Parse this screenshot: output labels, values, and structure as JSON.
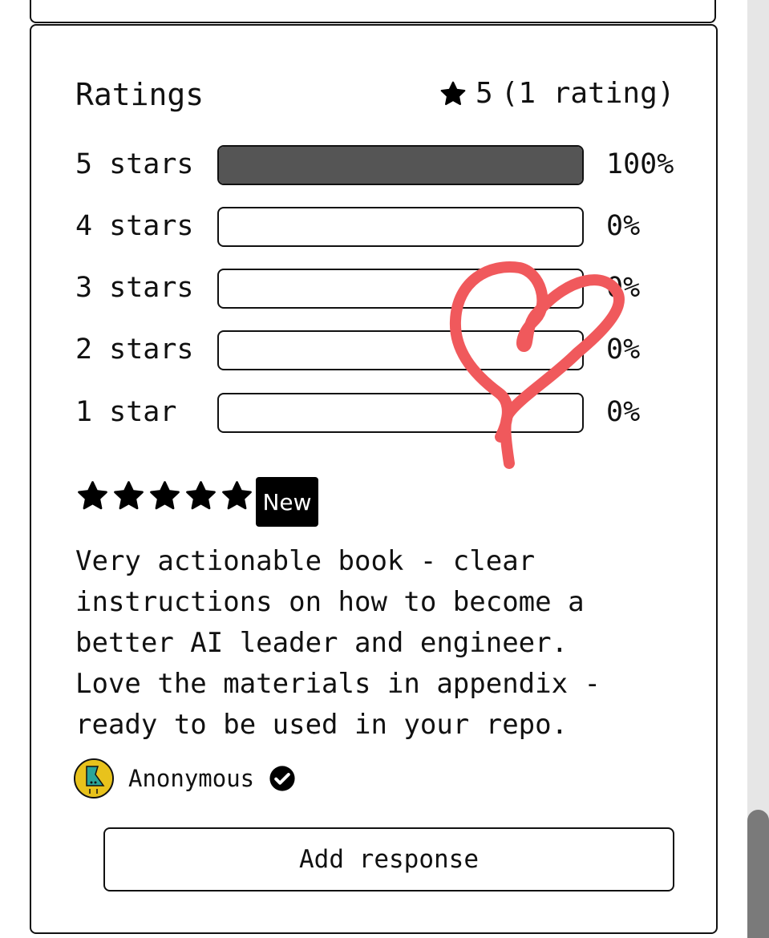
{
  "ratings": {
    "title": "Ratings",
    "average": "5",
    "count_text": "(1 rating)",
    "rows": [
      {
        "label": "5 stars",
        "percent_text": "100%",
        "fraction": 1.0
      },
      {
        "label": "4 stars",
        "percent_text": "0%",
        "fraction": 0
      },
      {
        "label": "3 stars",
        "percent_text": "0%",
        "fraction": 0
      },
      {
        "label": "2 stars",
        "percent_text": "0%",
        "fraction": 0
      },
      {
        "label": "1 star",
        "percent_text": "0%",
        "fraction": 0
      }
    ]
  },
  "review": {
    "stars": 5,
    "badge": "New",
    "lines": [
      "Very actionable book - clear",
      "instructions on how to become a",
      "better AI leader and engineer.",
      "Love the materials in appendix -",
      "ready to be used in your repo."
    ],
    "author": "Anonymous"
  },
  "actions": {
    "add_response": "Add response"
  },
  "icons": {
    "star": "star-icon",
    "verified": "check-circle-icon",
    "heart": "heart-doodle-icon"
  },
  "colors": {
    "bar_fill": "#555555",
    "heart": "#f0595c",
    "badge_bg": "#000000"
  }
}
